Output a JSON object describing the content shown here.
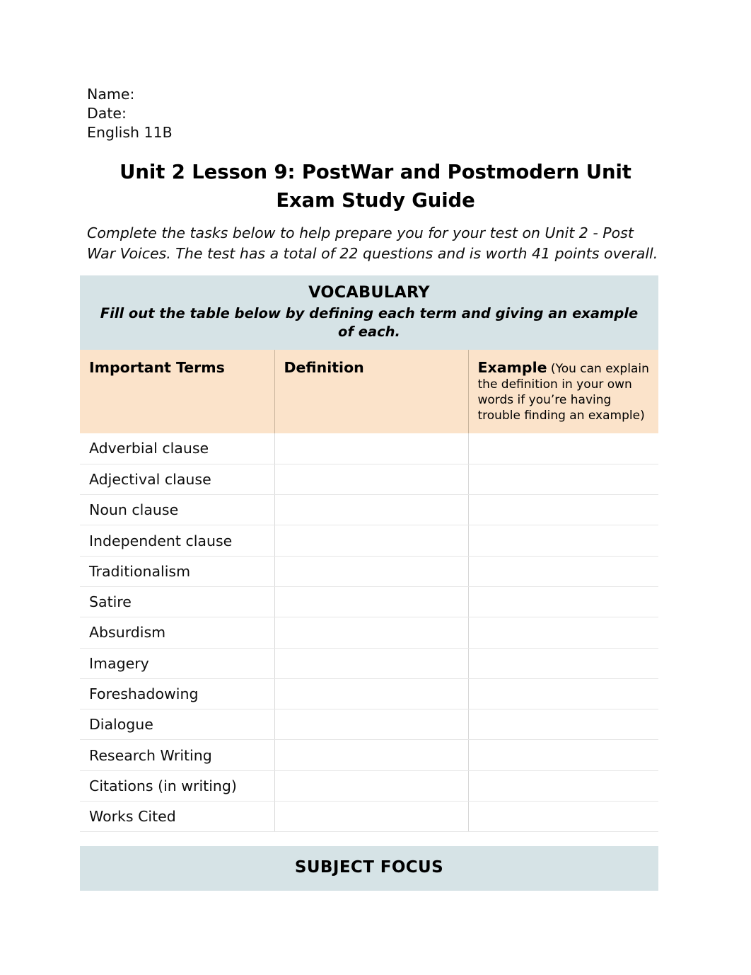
{
  "header": {
    "name_line": "Name:",
    "date_line": "Date:",
    "course_line": "English 11B"
  },
  "title": "Unit 2 Lesson 9: PostWar and Postmodern Unit Exam Study Guide",
  "intro": "Complete the tasks below to help prepare you for your test on Unit 2 - Post War Voices. The test has a total of 22 questions and is worth 41 points overall.",
  "vocabulary_banner": {
    "title": "VOCABULARY",
    "subtitle": "Fill out the table below by defining each term and giving an example of each."
  },
  "vocabulary_table": {
    "columns": {
      "terms": "Important Terms",
      "definition": "Definition",
      "example_label": "Example",
      "example_note": " (You can explain the definition in your own words if you’re having trouble finding an example)"
    },
    "rows": [
      {
        "term": "Adverbial clause",
        "definition": "",
        "example": ""
      },
      {
        "term": "Adjectival clause",
        "definition": "",
        "example": ""
      },
      {
        "term": "Noun clause",
        "definition": "",
        "example": ""
      },
      {
        "term": "Independent clause",
        "definition": "",
        "example": ""
      },
      {
        "term": "Traditionalism",
        "definition": "",
        "example": ""
      },
      {
        "term": "Satire",
        "definition": "",
        "example": ""
      },
      {
        "term": "Absurdism",
        "definition": "",
        "example": ""
      },
      {
        "term": "Imagery",
        "definition": "",
        "example": ""
      },
      {
        "term": "Foreshadowing",
        "definition": "",
        "example": ""
      },
      {
        "term": "Dialogue",
        "definition": "",
        "example": ""
      },
      {
        "term": "Research Writing",
        "definition": "",
        "example": ""
      },
      {
        "term": "Citations (in writing)",
        "definition": "",
        "example": ""
      },
      {
        "term": "Works Cited",
        "definition": "",
        "example": ""
      }
    ]
  },
  "subject_focus_banner": {
    "title": "SUBJECT FOCUS"
  },
  "colors": {
    "banner_bg": "#d6e3e6",
    "table_header_bg": "#fbe3ca",
    "row_separator": "#e6e6e6",
    "page_bg": "#ffffff",
    "text": "#0d0d0d"
  }
}
